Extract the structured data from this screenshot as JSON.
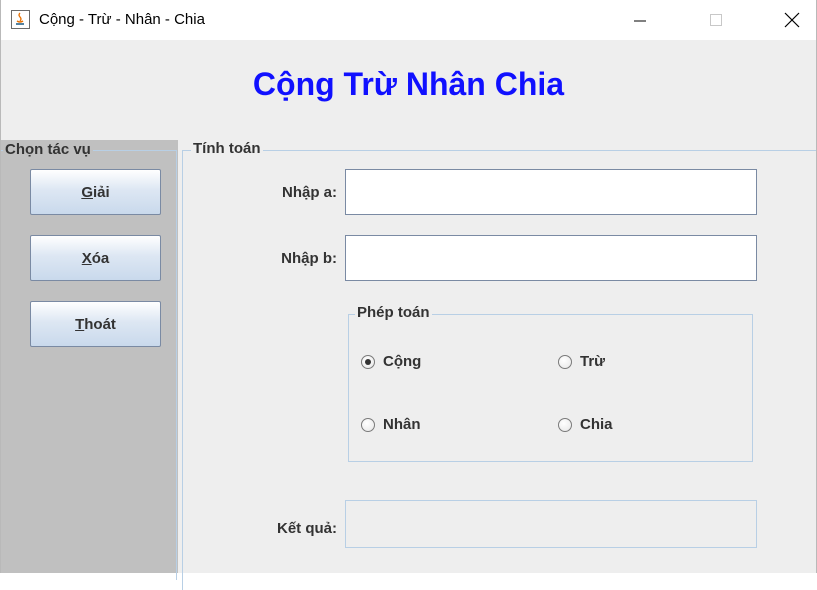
{
  "window": {
    "title": "Cộng - Trừ - Nhân - Chia",
    "icon": "java-cup-icon",
    "controls": [
      "minimize-icon",
      "maximize-icon",
      "close-icon"
    ]
  },
  "header": {
    "title": "Cộng Trừ Nhân Chia",
    "color": "#1010ff"
  },
  "left_panel": {
    "title": "Chọn tác vụ",
    "buttons": [
      {
        "label": "Giải",
        "mnemonic": "G",
        "rest": "iải"
      },
      {
        "label": "Xóa",
        "mnemonic": "X",
        "rest": "óa"
      },
      {
        "label": "Thoát",
        "mnemonic": "T",
        "rest": "hoát"
      }
    ],
    "background": "#c0c0c0"
  },
  "calc_panel": {
    "title": "Tính toán",
    "input_a": {
      "label": "Nhập a:",
      "value": ""
    },
    "input_b": {
      "label": "Nhập b:",
      "value": ""
    },
    "operations": {
      "title": "Phép toán",
      "options": [
        {
          "label": "Cộng",
          "selected": true
        },
        {
          "label": "Trừ",
          "selected": false
        },
        {
          "label": "Nhân",
          "selected": false
        },
        {
          "label": "Chia",
          "selected": false
        }
      ]
    },
    "result": {
      "label": "Kết quả:",
      "value": ""
    }
  }
}
